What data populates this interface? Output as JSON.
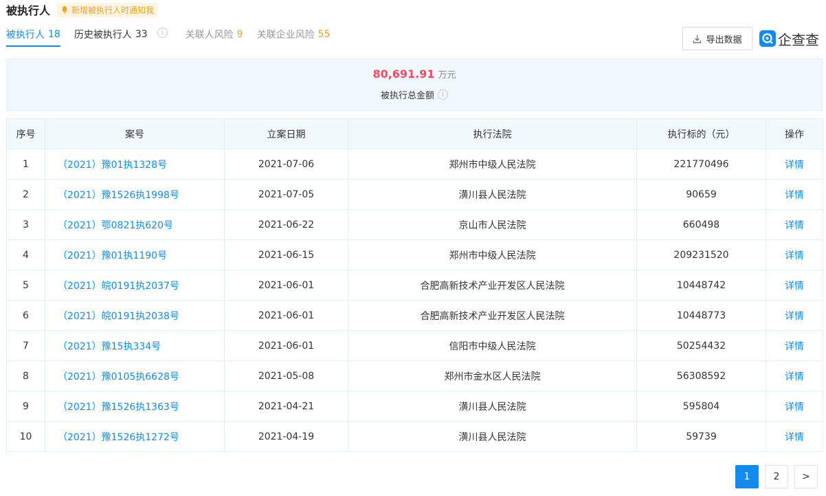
{
  "header": {
    "title": "被执行人",
    "notify_label": "新增被执行人时通知我"
  },
  "tabs": [
    {
      "label": "被执行人",
      "count": "18"
    },
    {
      "label": "历史被执行人",
      "count": "33"
    },
    {
      "label": "关联人风险",
      "count": "9"
    },
    {
      "label": "关联企业风险",
      "count": "55"
    }
  ],
  "toolbar": {
    "export_label": "导出数据",
    "logo_text": "企查查"
  },
  "summary": {
    "value": "80,691.91",
    "unit": "万元",
    "label": "被执行总金额"
  },
  "table": {
    "headers": [
      "序号",
      "案号",
      "立案日期",
      "执行法院",
      "执行标的（元）",
      "操作"
    ],
    "rows": [
      [
        "1",
        "（2021）豫01执1328号",
        "2021-07-06",
        "郑州市中级人民法院",
        "221770496",
        "详情"
      ],
      [
        "2",
        "（2021）豫1526执1998号",
        "2021-07-05",
        "潢川县人民法院",
        "90659",
        "详情"
      ],
      [
        "3",
        "（2021）鄂0821执620号",
        "2021-06-22",
        "京山市人民法院",
        "660498",
        "详情"
      ],
      [
        "4",
        "（2021）豫01执1190号",
        "2021-06-15",
        "郑州市中级人民法院",
        "209231520",
        "详情"
      ],
      [
        "5",
        "（2021）皖0191执2037号",
        "2021-06-01",
        "合肥高新技术产业开发区人民法院",
        "10448742",
        "详情"
      ],
      [
        "6",
        "（2021）皖0191执2038号",
        "2021-06-01",
        "合肥高新技术产业开发区人民法院",
        "10448773",
        "详情"
      ],
      [
        "7",
        "（2021）豫15执334号",
        "2021-06-01",
        "信阳市中级人民法院",
        "50254432",
        "详情"
      ],
      [
        "8",
        "（2021）豫0105执6628号",
        "2021-05-08",
        "郑州市金水区人民法院",
        "56308592",
        "详情"
      ],
      [
        "9",
        "（2021）豫1526执1363号",
        "2021-04-21",
        "潢川县人民法院",
        "595804",
        "详情"
      ],
      [
        "10",
        "（2021）豫1526执1272号",
        "2021-04-19",
        "潢川县人民法院",
        "59739",
        "详情"
      ]
    ]
  },
  "pagination": {
    "pages": [
      "1",
      "2"
    ],
    "current": "1",
    "next_label": ">"
  },
  "colors": {
    "accent": "#128bed",
    "amount": "#fd485e",
    "warning": "#f0a020"
  },
  "icons": {
    "bell": "bell-icon",
    "info": "info-icon",
    "download": "download-icon",
    "logo": "qichacha-logo-icon"
  }
}
